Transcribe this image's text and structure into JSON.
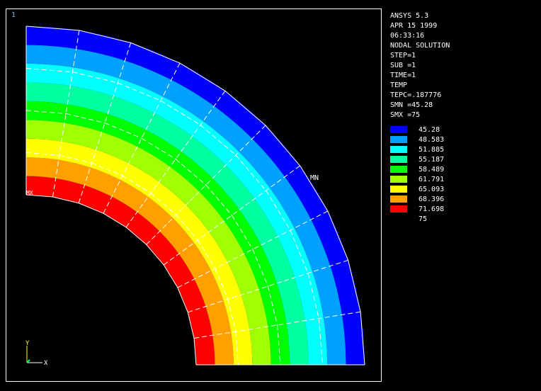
{
  "window_number": "1",
  "info": {
    "lines": [
      "ANSYS 5.3",
      "APR 15 1999",
      "06:33:16",
      "NODAL SOLUTION",
      "STEP=1",
      "SUB =1",
      "TIME=1",
      "TEMP",
      "TEPC=.187776",
      "SMN =45.28",
      "SMX =75"
    ]
  },
  "legend": {
    "colors": [
      "#0000ff",
      "#00a0ff",
      "#00ffff",
      "#00ffa0",
      "#00ff00",
      "#a0ff00",
      "#ffff00",
      "#ffa000",
      "#ff0000"
    ],
    "values": [
      "45.28",
      "48.583",
      "51.885",
      "55.187",
      "58.489",
      "61.791",
      "65.093",
      "68.396",
      "71.698",
      "75"
    ]
  },
  "plot": {
    "min_label": "MN",
    "max_label": "MX",
    "axis_y": "Y",
    "axis_x": "X"
  }
}
